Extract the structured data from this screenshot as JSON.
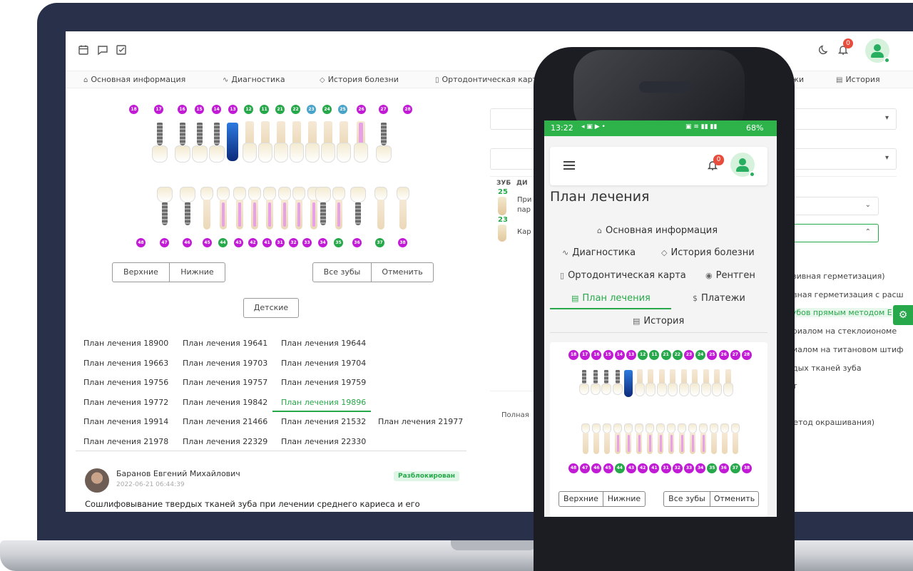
{
  "laptop": {
    "topbar": {
      "notifications_count": "0"
    },
    "nav": [
      {
        "icon": "home-icon",
        "glyph": "⌂",
        "label": "Основная информация"
      },
      {
        "icon": "activity-icon",
        "glyph": "∿",
        "label": "Диагностика"
      },
      {
        "icon": "tag-icon",
        "glyph": "◇",
        "label": "История болезни"
      },
      {
        "icon": "map-icon",
        "glyph": "▯",
        "label": "Ортодонтическая карта"
      },
      {
        "icon": "file-icon",
        "glyph": "▤",
        "label": "История"
      }
    ],
    "nav_partial": "жи",
    "upper_teeth": [
      {
        "num": "18",
        "color": "purple"
      },
      {
        "num": "17",
        "color": "purple"
      },
      {
        "num": "16",
        "color": "purple"
      },
      {
        "num": "15",
        "color": "purple"
      },
      {
        "num": "14",
        "color": "purple"
      },
      {
        "num": "13",
        "color": "purple"
      },
      {
        "num": "12",
        "color": "green"
      },
      {
        "num": "11",
        "color": "green"
      },
      {
        "num": "21",
        "color": "green"
      },
      {
        "num": "22",
        "color": "green"
      },
      {
        "num": "23",
        "color": "blue"
      },
      {
        "num": "24",
        "color": "green"
      },
      {
        "num": "25",
        "color": "blue"
      },
      {
        "num": "26",
        "color": "purple"
      },
      {
        "num": "27",
        "color": "purple"
      },
      {
        "num": "28",
        "color": "purple"
      }
    ],
    "lower_teeth": [
      {
        "num": "48",
        "color": "purple"
      },
      {
        "num": "47",
        "color": "purple"
      },
      {
        "num": "46",
        "color": "purple"
      },
      {
        "num": "45",
        "color": "purple"
      },
      {
        "num": "44",
        "color": "green"
      },
      {
        "num": "43",
        "color": "purple"
      },
      {
        "num": "42",
        "color": "purple"
      },
      {
        "num": "41",
        "color": "purple"
      },
      {
        "num": "31",
        "color": "purple"
      },
      {
        "num": "32",
        "color": "purple"
      },
      {
        "num": "33",
        "color": "purple"
      },
      {
        "num": "34",
        "color": "purple"
      },
      {
        "num": "35",
        "color": "green"
      },
      {
        "num": "36",
        "color": "purple"
      },
      {
        "num": "37",
        "color": "green"
      },
      {
        "num": "38",
        "color": "purple"
      }
    ],
    "buttons": {
      "upper": "Верхние",
      "lower": "Нижние",
      "all": "Все зубы",
      "cancel": "Отменить",
      "kids": "Детские"
    },
    "plans": [
      [
        "План лечения 18900",
        "План лечения 19641",
        "План лечения 19644"
      ],
      [
        "План лечения 19663",
        "План лечения 19703",
        "План лечения 19704"
      ],
      [
        "План лечения 19756",
        "План лечения 19757",
        "План лечения 19759"
      ],
      [
        "План лечения 19772",
        "План лечения 19842",
        "План лечения 19896"
      ],
      [
        "План лечения 19914",
        "План лечения 21466",
        "План лечения 21532",
        "План лечения 21977"
      ],
      [
        "План лечения 21978",
        "План лечения 22329",
        "План лечения 22330"
      ]
    ],
    "comment": {
      "author": "Баранов Евгений Михайлович",
      "date": "2022-06-21 06:44:39",
      "status": "Разблокирован",
      "text": "Сошлифовывание твердых тканей зуба при лечении среднего кариеса и его"
    },
    "right_pane": {
      "col_tooth": "ЗУБ",
      "col_diag": "ДИ",
      "row1_tooth": "25",
      "row1_text_a": "При",
      "row1_text_b": "пар",
      "row2_tooth": "23",
      "row2_text": "Кар",
      "footer_text": "Полная",
      "dropdown_items": [
        "озивная герметизация)",
        "ивная герметизация с расш",
        "зубов прямым методом Е",
        "ериалом на стеклоиономе",
        "риалом на титановом штиф",
        "рдых тканей зуба",
        "ит",
        "метод окрашивания)"
      ],
      "dropdown_active_index": 2
    }
  },
  "phone": {
    "status": {
      "time": "13:22",
      "battery": "68%"
    },
    "notifications_count": "0",
    "title": "План лечения",
    "tabs": [
      {
        "icon": "home-icon",
        "glyph": "⌂",
        "label": "Основная информация"
      },
      {
        "icon": "activity-icon",
        "glyph": "∿",
        "label": "Диагностика"
      },
      {
        "icon": "tag-icon",
        "glyph": "◇",
        "label": "История болезни"
      },
      {
        "icon": "map-icon",
        "glyph": "▯",
        "label": "Ортодонтическая карта"
      },
      {
        "icon": "radio-icon",
        "glyph": "◉",
        "label": "Рентген"
      },
      {
        "icon": "file-plus-icon",
        "glyph": "▤",
        "label": "План лечения"
      },
      {
        "icon": "dollar-icon",
        "glyph": "$",
        "label": "Платежи"
      },
      {
        "icon": "file-icon",
        "glyph": "▤",
        "label": "История"
      }
    ],
    "active_tab_index": 5,
    "upper_nums": [
      {
        "num": "18",
        "color": "purple"
      },
      {
        "num": "17",
        "color": "purple"
      },
      {
        "num": "16",
        "color": "purple"
      },
      {
        "num": "15",
        "color": "purple"
      },
      {
        "num": "14",
        "color": "purple"
      },
      {
        "num": "13",
        "color": "purple"
      },
      {
        "num": "12",
        "color": "green"
      },
      {
        "num": "11",
        "color": "green"
      },
      {
        "num": "21",
        "color": "green"
      },
      {
        "num": "22",
        "color": "green"
      },
      {
        "num": "23",
        "color": "purple"
      },
      {
        "num": "24",
        "color": "green"
      },
      {
        "num": "25",
        "color": "purple"
      },
      {
        "num": "26",
        "color": "purple"
      },
      {
        "num": "27",
        "color": "purple"
      },
      {
        "num": "28",
        "color": "purple"
      }
    ],
    "lower_nums": [
      {
        "num": "48",
        "color": "purple"
      },
      {
        "num": "47",
        "color": "purple"
      },
      {
        "num": "46",
        "color": "purple"
      },
      {
        "num": "45",
        "color": "purple"
      },
      {
        "num": "44",
        "color": "green"
      },
      {
        "num": "43",
        "color": "purple"
      },
      {
        "num": "42",
        "color": "purple"
      },
      {
        "num": "41",
        "color": "purple"
      },
      {
        "num": "31",
        "color": "purple"
      },
      {
        "num": "32",
        "color": "purple"
      },
      {
        "num": "33",
        "color": "purple"
      },
      {
        "num": "34",
        "color": "purple"
      },
      {
        "num": "35",
        "color": "green"
      },
      {
        "num": "36",
        "color": "purple"
      },
      {
        "num": "37",
        "color": "green"
      },
      {
        "num": "38",
        "color": "purple"
      }
    ],
    "buttons": {
      "upper": "Верхние",
      "lower": "Нижние",
      "all": "Все зубы",
      "cancel": "Отменить"
    }
  },
  "colors": {
    "accent": "#27a84a",
    "purple": "#c21bd6",
    "blue": "#4aa3c9",
    "frame": "#283149"
  }
}
